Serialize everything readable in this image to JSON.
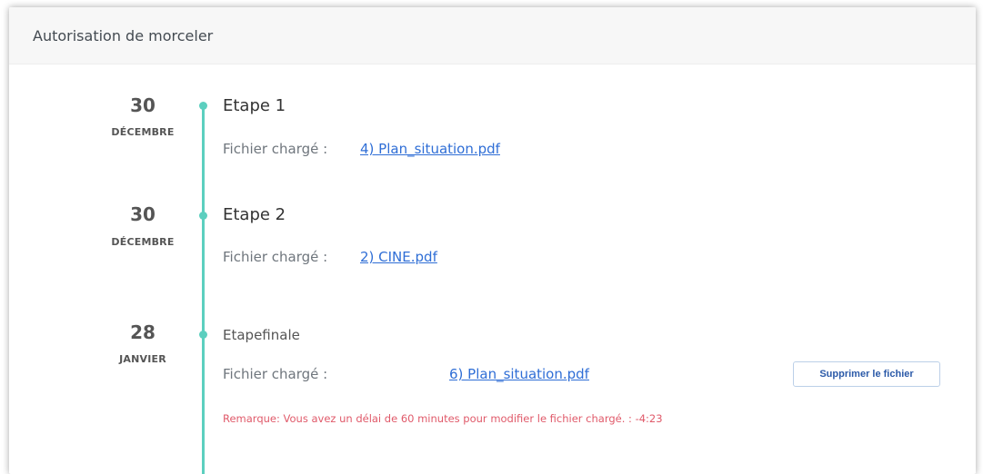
{
  "panel": {
    "title": "Autorisation de morceler"
  },
  "steps": [
    {
      "day": "30",
      "month": "DÉCEMBRE",
      "title": "Etape 1",
      "file_label": "Fichier chargé :",
      "file_link": "4) Plan_situation.pdf"
    },
    {
      "day": "30",
      "month": "DÉCEMBRE",
      "title": "Etape 2",
      "file_label": "Fichier chargé :",
      "file_link": "2) CINE.pdf"
    },
    {
      "day": "28",
      "month": "JANVIER",
      "title": "Etapefinale",
      "file_label": "Fichier chargé :",
      "file_link": "6) Plan_situation.pdf",
      "delete_button": "Supprimer le fichier",
      "remark": "Remarque: Vous avez un délai de 60 minutes pour modifier le fichier chargé. : -4:23"
    }
  ],
  "colors": {
    "timeline": "#5ccfbf",
    "link": "#2f6ed6",
    "remark": "#e05a6a",
    "button_text": "#2b5aa8"
  }
}
